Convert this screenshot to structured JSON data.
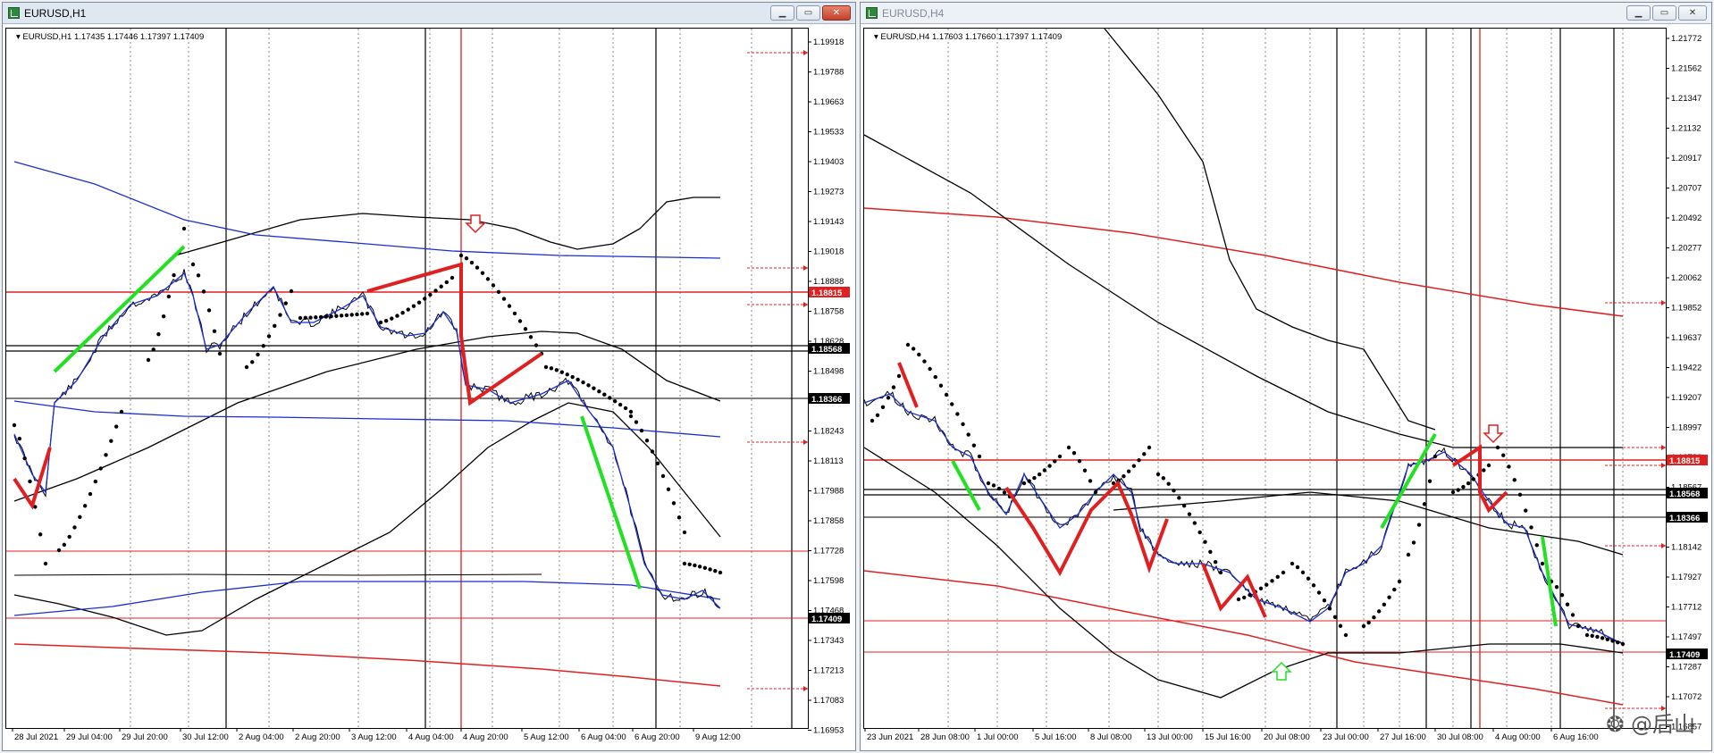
{
  "windows": [
    {
      "title": "EURUSD,H1",
      "info": "EURUSD,H1  1.17435 1.17446 1.17397 1.17409",
      "price_labels": [
        "1.19918",
        "1.19788",
        "1.19663",
        "1.19533",
        "1.19403",
        "1.19273",
        "1.19143",
        "1.19018",
        "1.18888",
        "1.18758",
        "1.18628",
        "1.18498",
        "1.18366",
        "1.18243",
        "1.18113",
        "1.17988",
        "1.17858",
        "1.17728",
        "1.17598",
        "1.17468",
        "1.17343",
        "1.17213",
        "1.17083",
        "1.16953"
      ],
      "date_labels": [
        "28 Jul 2021",
        "29 Jul 04:00",
        "29 Jul 20:00",
        "30 Jul 12:00",
        "2 Aug 04:00",
        "2 Aug 20:00",
        "3 Aug 12:00",
        "4 Aug 04:00",
        "4 Aug 20:00",
        "5 Aug 12:00",
        "6 Aug 04:00",
        "6 Aug 20:00",
        "9 Aug 12:00"
      ],
      "price_tags": [
        {
          "value": "1.18815",
          "color": "#e02020"
        },
        {
          "value": "1.18568",
          "color": "#000000"
        },
        {
          "value": "1.18366",
          "color": "#000000"
        },
        {
          "value": "1.17409",
          "color": "#000000"
        }
      ]
    },
    {
      "title": "EURUSD,H4",
      "info": "EURUSD,H4  1.17603 1.17660 1.17397 1.17409",
      "price_labels": [
        "1.21772",
        "1.21562",
        "1.21347",
        "1.21132",
        "1.20917",
        "1.20707",
        "1.20492",
        "1.20277",
        "1.20062",
        "1.19852",
        "1.19637",
        "1.19422",
        "1.19207",
        "1.18997",
        "1.18782",
        "1.18567",
        "1.18357",
        "1.18142",
        "1.17927",
        "1.17712",
        "1.17497",
        "1.17287",
        "1.17072",
        "1.16857"
      ],
      "date_labels": [
        "23 Jun 2021",
        "28 Jun 08:00",
        "1 Jul 00:00",
        "5 Jul 16:00",
        "8 Jul 08:00",
        "13 Jul 00:00",
        "15 Jul 16:00",
        "20 Jul 08:00",
        "23 Jul 00:00",
        "27 Jul 16:00",
        "30 Jul 08:00",
        "4 Aug 00:00",
        "6 Aug 16:00"
      ],
      "price_tags": [
        {
          "value": "1.18815",
          "color": "#e02020"
        },
        {
          "value": "1.18568",
          "color": "#000000"
        },
        {
          "value": "1.18366",
          "color": "#000000"
        },
        {
          "value": "1.17409",
          "color": "#000000"
        }
      ],
      "watermark": "❂ @后山"
    }
  ],
  "colors": {
    "accent_red": "#e02020",
    "ma_blue": "#1a2fd0",
    "up_green": "#22e022",
    "cyan": "#22dddd"
  }
}
